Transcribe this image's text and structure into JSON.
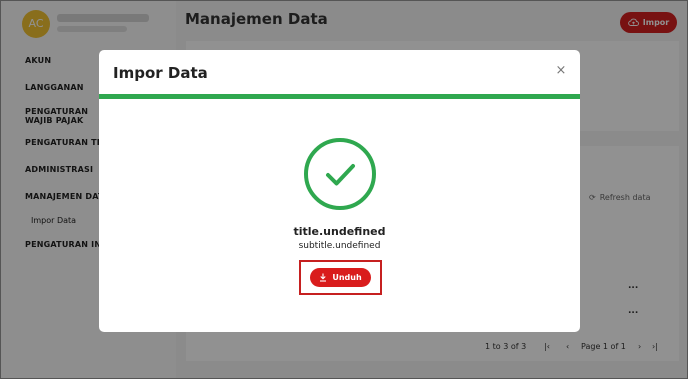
{
  "user": {
    "initials": "AC"
  },
  "sidebar": {
    "items": [
      {
        "label": "AKUN"
      },
      {
        "label": "LANGGANAN"
      },
      {
        "label": "PENGATURAN WAJIB PAJAK"
      },
      {
        "label": "PENGATURAN TRA"
      },
      {
        "label": "ADMINISTRASI"
      },
      {
        "label": "MANAJEMEN DATA"
      },
      {
        "label": "PENGATURAN INT"
      }
    ],
    "sub_items": [
      {
        "label": "Impor Data"
      }
    ]
  },
  "header": {
    "title": "Manajemen Data",
    "import_label": "Impor"
  },
  "table": {
    "refresh_label": "Refresh data",
    "range_label": "1 to 3 of 3",
    "page_label": "Page 1 of 1",
    "row_actions": [
      "...",
      "...",
      "..."
    ]
  },
  "modal": {
    "title": "Impor Data",
    "close_glyph": "×",
    "status_title": "title.undefined",
    "status_subtitle": "subtitle.undefined",
    "download_label": "Unduh",
    "accent_color": "#2fa84f",
    "button_color": "#d91c1c"
  },
  "pager_glyphs": {
    "first": "|‹",
    "prev": "‹",
    "next": "›",
    "last": "›|"
  }
}
